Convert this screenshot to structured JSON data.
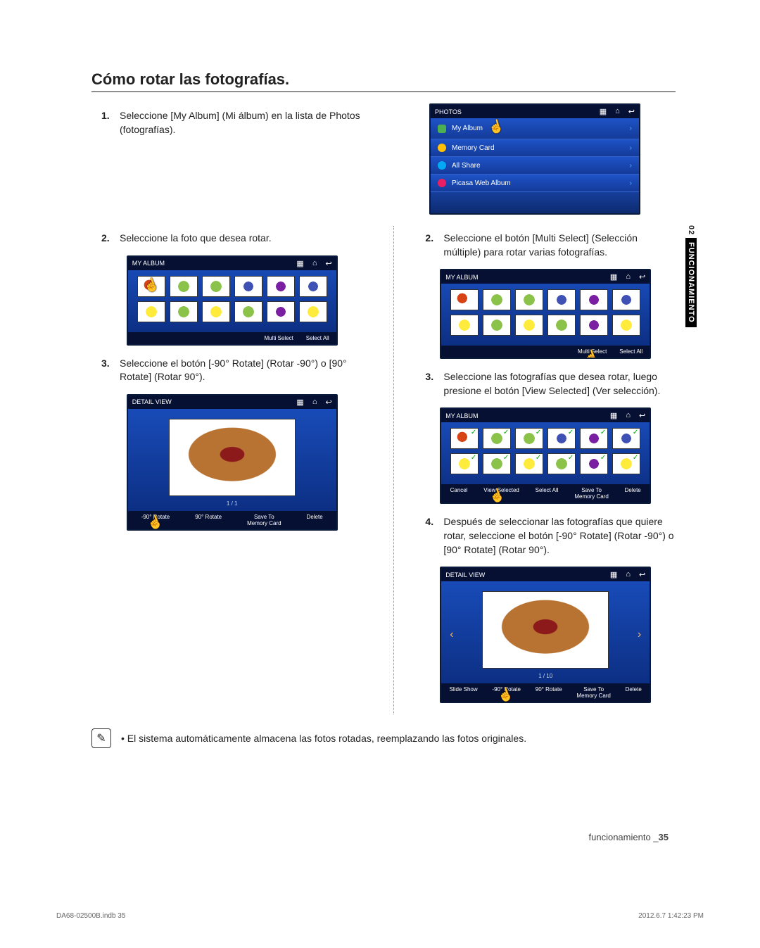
{
  "title": "Cómo rotar las fotografías.",
  "side_tab": {
    "prefix": "02 ",
    "label": "FUNCIONAMIENTO"
  },
  "left": {
    "step1": {
      "num": "1.",
      "text": "Seleccione [My Album] (Mi álbum) en la lista de Photos (fotografías)."
    },
    "step2": {
      "num": "2.",
      "text": "Seleccione la foto que desea rotar."
    },
    "step3": {
      "num": "3.",
      "text": "Seleccione el botón [-90° Rotate] (Rotar -90°) o [90° Rotate] (Rotar 90°)."
    }
  },
  "right": {
    "step2": {
      "num": "2.",
      "text": "Seleccione el botón [Multi Select] (Selección múltiple) para rotar varias fotografías."
    },
    "step3": {
      "num": "3.",
      "text": "Seleccione las fotografías que desea rotar, luego presione el botón [View Selected] (Ver selección)."
    },
    "step4": {
      "num": "4.",
      "text": "Después de seleccionar las fotografías que quiere rotar, seleccione el botón [-90° Rotate] (Rotar -90°) o [90° Rotate] (Rotar 90°)."
    }
  },
  "note": "El sistema automáticamente almacena las fotos rotadas, reemplazando las fotos originales.",
  "footer": {
    "section": "funcionamiento _",
    "page": "35"
  },
  "print": {
    "left": "DA68-02500B.indb   35",
    "right": "2012.6.7   1:42:23 PM"
  },
  "screens": {
    "photos": {
      "header": "PHOTOS",
      "items": [
        "My Album",
        "Memory Card",
        "All Share",
        "Picasa Web Album"
      ]
    },
    "album": {
      "header": "MY ALBUM",
      "buttons": {
        "multi": "Multi Select",
        "all": "Select All"
      }
    },
    "album_select": {
      "header": "MY ALBUM",
      "buttons": {
        "cancel": "Cancel",
        "view": "View Selected",
        "all": "Select All",
        "save": "Save To\nMemory Card",
        "del": "Delete"
      }
    },
    "detail": {
      "header": "DETAIL VIEW",
      "pager1": "1 / 1",
      "pager10": "1 / 10",
      "buttons_a": {
        "neg": "-90° Rotate",
        "pos": "90° Rotate",
        "save": "Save To\nMemory Card",
        "del": "Delete"
      },
      "buttons_b": {
        "slide": "Slide Show",
        "neg": "-90° Rotate",
        "pos": "90° Rotate",
        "save": "Save To\nMemory Card",
        "del": "Delete"
      }
    }
  }
}
